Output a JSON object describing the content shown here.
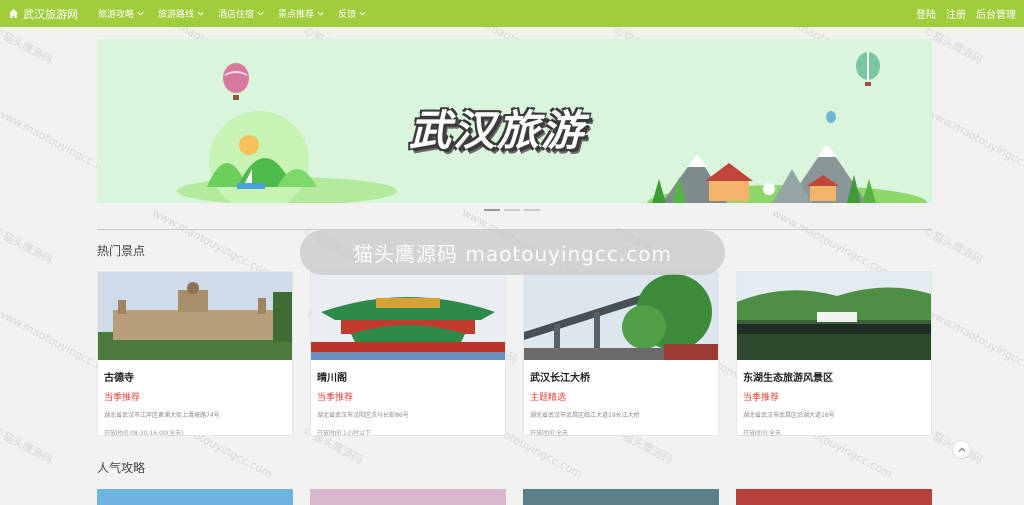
{
  "brand": {
    "name": "武汉旅游网",
    "icon": "home-icon"
  },
  "nav": [
    {
      "label": "旅游攻略"
    },
    {
      "label": "旅游路线"
    },
    {
      "label": "酒店住宿"
    },
    {
      "label": "景点推荐"
    },
    {
      "label": "反馈"
    }
  ],
  "right_nav": {
    "login": "登陆",
    "register": "注册",
    "admin": "后台管理"
  },
  "banner": {
    "title": "武汉旅游"
  },
  "watermark": {
    "pill_text": "猫头鹰源码 maotouyingcc.com",
    "tile_cn": "©猫头鹰源码",
    "tile_en": "www.maotouyingcc.com"
  },
  "sections": {
    "hot_spots": "热门景点",
    "popular_guides": "人气攻略"
  },
  "spots": [
    {
      "name": "古德寺",
      "tag": "当季推荐",
      "address": "湖北省武汉市江岸区黄浦大街上滑坡路74号",
      "hours": "开放时间:08:30-16:00(全天)"
    },
    {
      "name": "晴川阁",
      "tag": "当季推荐",
      "address": "湖北省武汉市汉阳区洗马长街86号",
      "hours": "开放时间:1小时以下"
    },
    {
      "name": "武汉长江大桥",
      "tag": "主题精选",
      "address": "湖北省武汉市武昌区临江大道19长江大桥",
      "hours": "开放时间:全天"
    },
    {
      "name": "东湖生态旅游风景区",
      "tag": "当季推荐",
      "address": "湖北省武汉市武昌区沿湖大道16号",
      "hours": "开放时间:全天"
    }
  ],
  "colors": {
    "accent": "#9fcd3b",
    "tag": "#e0473c"
  }
}
